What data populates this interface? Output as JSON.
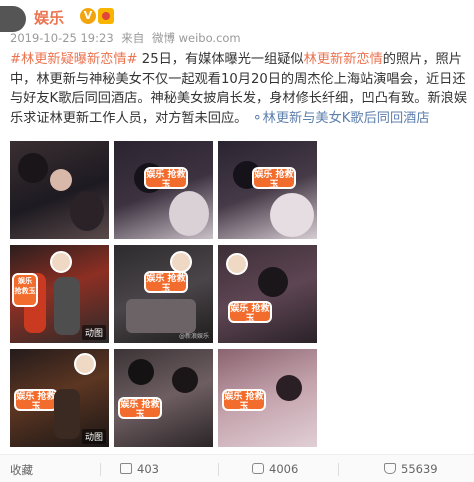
{
  "header": {
    "author": "娱乐",
    "vip_badge": "V",
    "timestamp": "2019-10-25 19:23",
    "source_prefix": "来自",
    "source": "微博 weibo.com"
  },
  "post": {
    "hashtag": "#林更新疑曝新恋情#",
    "seg1": " 25日，有媒体曝光一组疑似",
    "inline_link": "林更新新恋情",
    "seg2": "的照片，照片中，林更新与神秘美女不仅一起观看10月20日的周杰伦上海站演唱会，近日还与好友K歌后同回酒店。神秘美女披肩长发，身材修长纤细，凹凸有致。新浪娱乐求证林更新工作人员，对方暂未回应。",
    "topic_icon": "link-icon",
    "topic": "林更新与美女K歌后同回酒店"
  },
  "images": {
    "stamp_text": "娱乐 抢救玉",
    "gif_label": "动图",
    "watermark": "@新浪娱乐"
  },
  "footer": {
    "favorite_label": "收藏",
    "share_count": "403",
    "comment_count": "4006",
    "like_count": "55639"
  },
  "colors": {
    "accent": "#eb7350",
    "link": "#5d7fad"
  }
}
